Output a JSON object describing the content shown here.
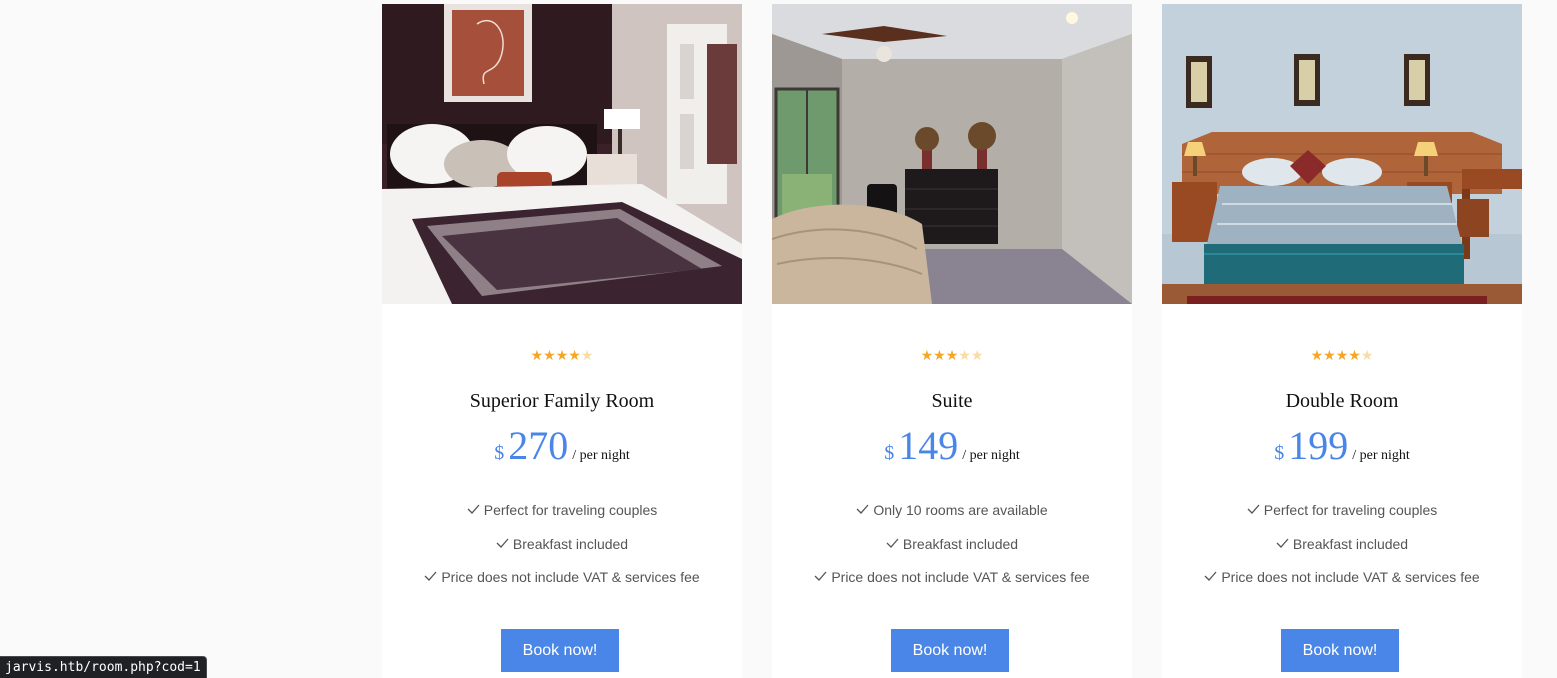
{
  "rooms": [
    {
      "image": "hotel-bedroom-photo",
      "rating": 4,
      "max_rating": 5,
      "name": "Superior Family Room",
      "currency": "$",
      "price": "270",
      "per_night": "/ per night",
      "features": [
        "Perfect for traveling couples",
        "Breakfast included",
        "Price does not include VAT & services fee"
      ],
      "button_label": "Book now!"
    },
    {
      "image": "suite-bedroom-photo",
      "rating": 3,
      "max_rating": 5,
      "name": "Suite",
      "currency": "$",
      "price": "149",
      "per_night": "/ per night",
      "features": [
        "Only 10 rooms are available",
        "Breakfast included",
        "Price does not include VAT & services fee"
      ],
      "button_label": "Book now!"
    },
    {
      "image": "double-room-photo",
      "rating": 4,
      "max_rating": 5,
      "name": "Double Room",
      "currency": "$",
      "price": "199",
      "per_night": "/ per night",
      "features": [
        "Perfect for traveling couples",
        "Breakfast included",
        "Price does not include VAT & services fee"
      ],
      "button_label": "Book now!"
    }
  ],
  "status_bar": {
    "url": "jarvis.htb/room.php?cod=1"
  },
  "colors": {
    "accent": "#4a86e8",
    "star": "#f5a623",
    "star_empty": "#f8dca4",
    "page_bg": "#fafafa"
  }
}
